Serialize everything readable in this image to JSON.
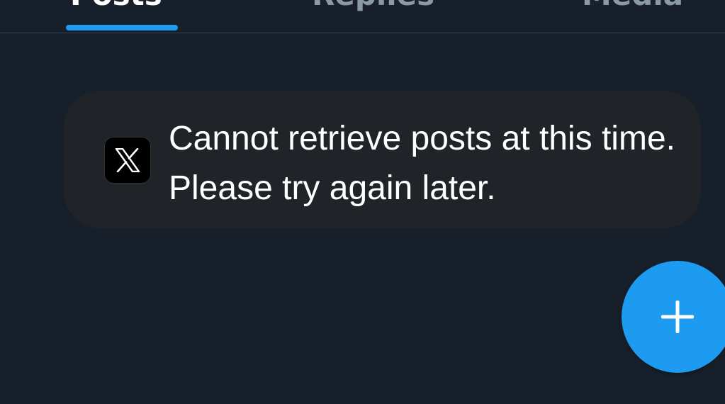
{
  "tabs": [
    {
      "label": "Posts",
      "active": true
    },
    {
      "label": "Replies",
      "active": false
    },
    {
      "label": "Media",
      "active": false
    }
  ],
  "notice": {
    "icon": "x-logo-icon",
    "message": "Cannot retrieve posts at this time. Please try again later."
  },
  "fab": {
    "icon": "plus-icon"
  },
  "colors": {
    "background": "#17202a",
    "notice_background": "#202327",
    "accent": "#1d9bf0",
    "text": "#ffffff",
    "inactive_tab": "#8b98a5"
  }
}
